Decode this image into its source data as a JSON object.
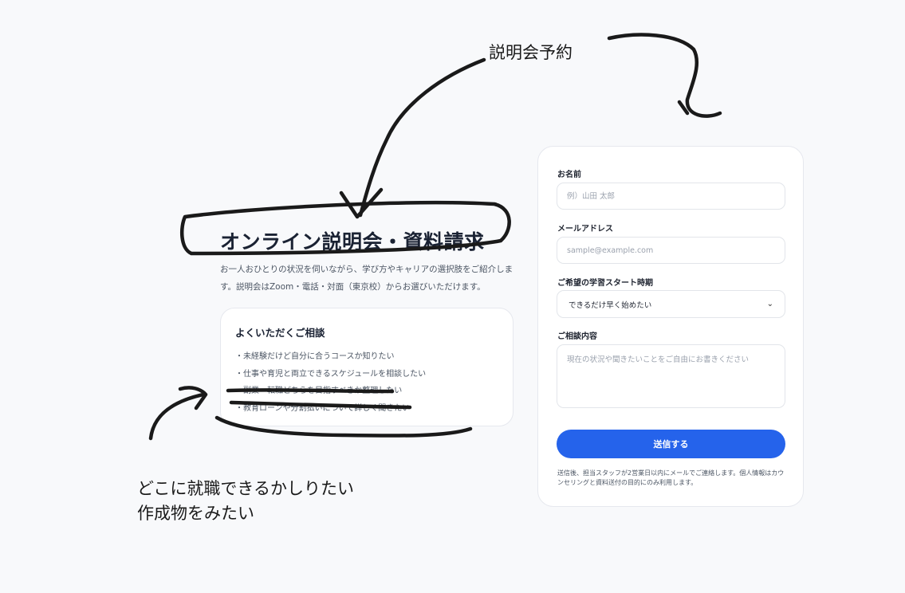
{
  "hero": {
    "title": "オンライン説明会・資料請求",
    "description": "お一人おひとりの状況を伺いながら、学び方やキャリアの選択肢をご紹介します。説明会はZoom・電話・対面（東京校）からお選びいただけます。"
  },
  "faq": {
    "title": "よくいただくご相談",
    "items": [
      "・未経験だけど自分に合うコースか知りたい",
      "・仕事や育児と両立できるスケジュールを相談したい",
      "・副業・転職どちらを目指すべきか整理したい",
      "・教育ローンや分割払いについて詳しく聞きたい"
    ]
  },
  "form": {
    "name_label": "お名前",
    "name_placeholder": "例）山田 太郎",
    "email_label": "メールアドレス",
    "email_placeholder": "sample@example.com",
    "start_label": "ご希望の学習スタート時期",
    "start_selected": "できるだけ早く始めたい",
    "inquiry_label": "ご相談内容",
    "inquiry_placeholder": "現在の状況や聞きたいことをご自由にお書きください",
    "submit_label": "送信する",
    "note": "送信後、担当スタッフが2営業日以内にメールでご連絡します。個人情報はカウンセリングと資料送付の目的にのみ利用します。"
  },
  "annotations": {
    "top": "説明会予約",
    "bottom_line1": "どこに就職できるかしりたい",
    "bottom_line2": "作成物をみたい"
  },
  "colors": {
    "accent": "#2563eb",
    "background": "#f8f9fb",
    "ink": "#1a1a1a"
  }
}
